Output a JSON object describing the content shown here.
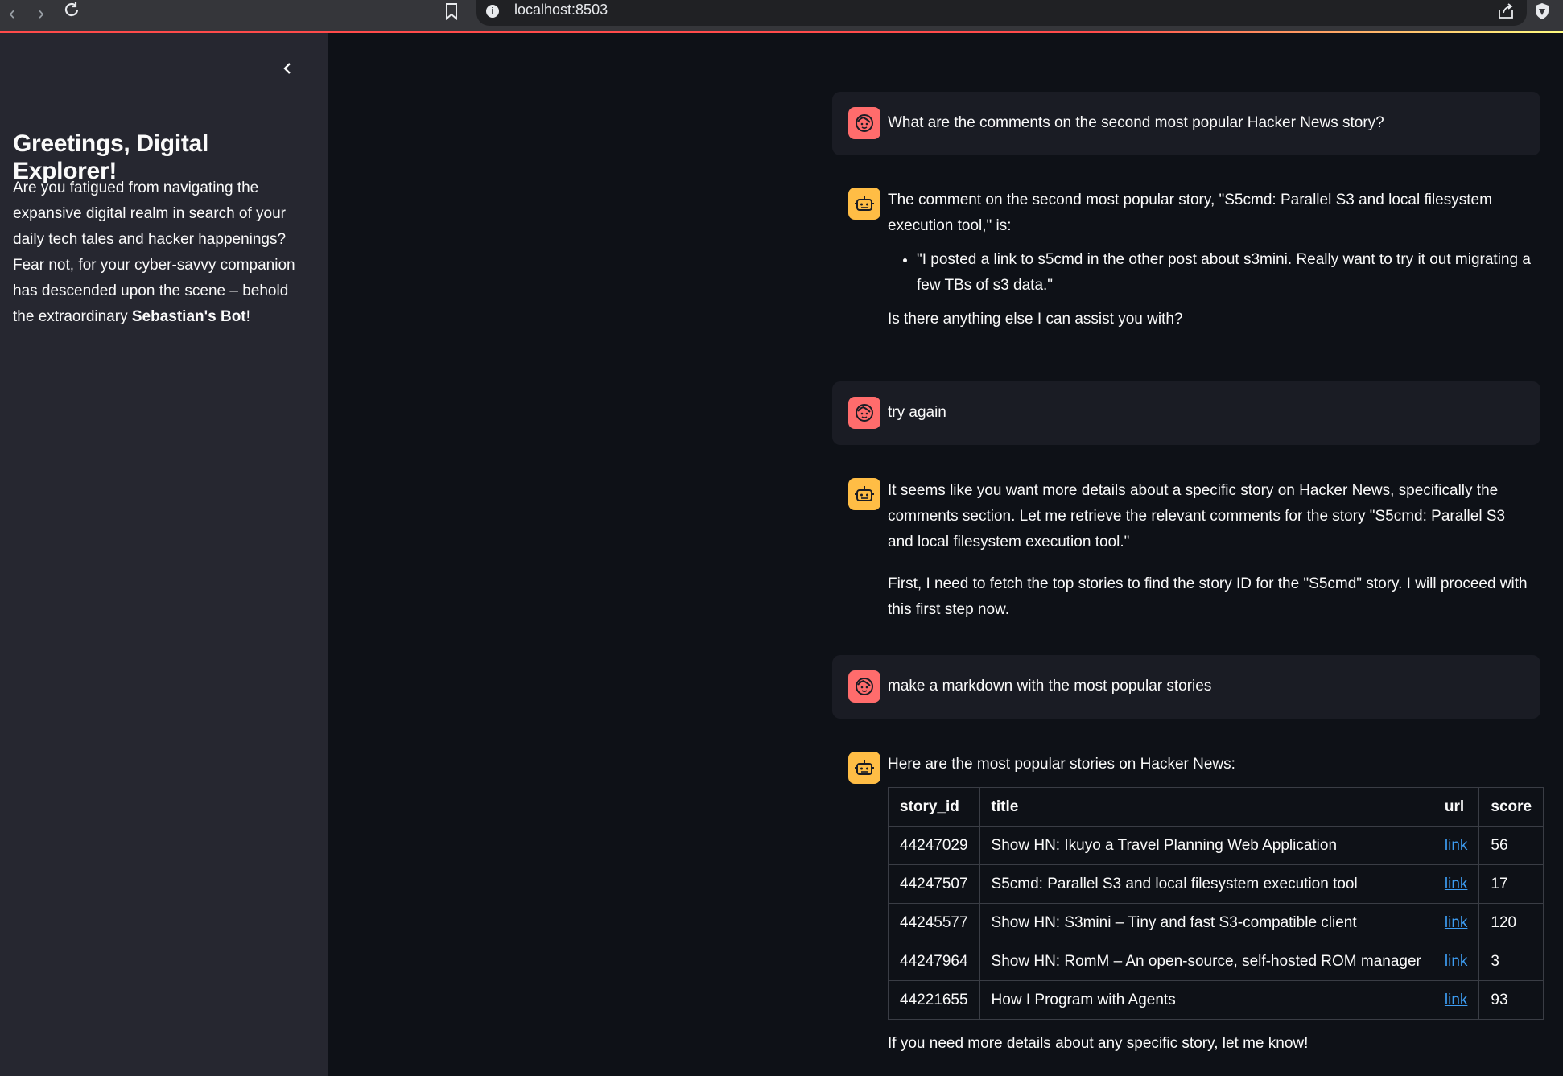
{
  "browser": {
    "url": "localhost:8503"
  },
  "sidebar": {
    "title": "Greetings, Digital Explorer!",
    "intro": "Are you fatigued from navigating the expansive digital realm in search of your daily tech tales and hacker happenings? Fear not, for your cyber-savvy companion has descended upon the scene – behold the extraordinary ",
    "bot_name": "Sebastian's Bot",
    "outro": "!"
  },
  "chat": {
    "q1": "What are the comments on the second most popular Hacker News story?",
    "a1_intro": "The comment on the second most popular story, \"S5cmd: Parallel S3 and local filesystem execution tool,\" is:",
    "a1_bullet": "\"I posted a link to s5cmd in the other post about s3mini. Really want to try it out migrating a few TBs of s3 data.\"",
    "a1_outro": "Is there anything else I can assist you with?",
    "q2": "try again",
    "a2_p1": "It seems like you want more details about a specific story on Hacker News, specifically the comments section. Let me retrieve the relevant comments for the story \"S5cmd: Parallel S3 and local filesystem execution tool.\"",
    "a2_p2": "First, I need to fetch the top stories to find the story ID for the \"S5cmd\" story. I will proceed with this first step now.",
    "q3": "make a markdown with the most popular stories",
    "a3_intro": "Here are the most popular stories on Hacker News:",
    "a3_outro": "If you need more details about any specific story, let me know!"
  },
  "table": {
    "headers": [
      "story_id",
      "title",
      "url",
      "score"
    ],
    "rows": [
      [
        "44247029",
        "Show HN: Ikuyo a Travel Planning Web Application",
        "link",
        "56"
      ],
      [
        "44247507",
        "S5cmd: Parallel S3 and local filesystem execution tool",
        "link",
        "17"
      ],
      [
        "44245577",
        "Show HN: S3mini – Tiny and fast S3-compatible client",
        "link",
        "120"
      ],
      [
        "44247964",
        "Show HN: RomM – An open-source, self-hosted ROM manager",
        "link",
        "3"
      ],
      [
        "44221655",
        "How I Program with Agents",
        "link",
        "93"
      ]
    ]
  },
  "colors": {
    "background": "#0e1117",
    "sidebar": "#262730",
    "user_avatar": "#ff6c6c",
    "bot_avatar": "#ffbd45",
    "link": "#3d9df3"
  }
}
